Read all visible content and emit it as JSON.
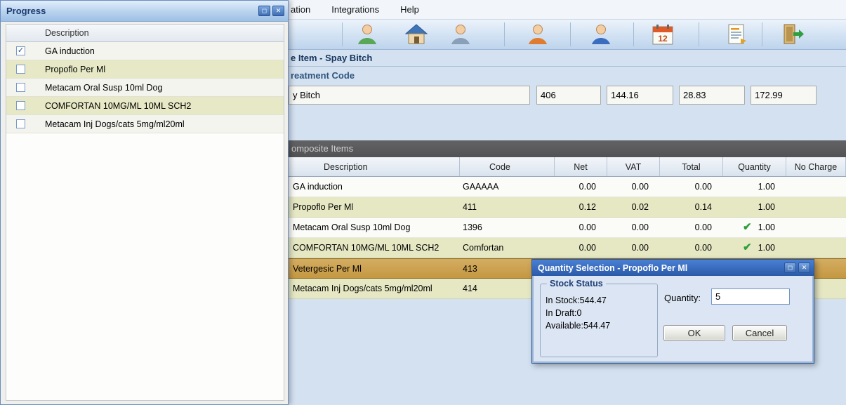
{
  "icons": {
    "check_green": "✔",
    "checkbox_check": "✓",
    "restore": "◻",
    "close": "✕"
  },
  "colors": {
    "selected_row": "#c9a052",
    "alt_row": "#e6e8c4",
    "accent_blue": "#2f62b0",
    "check_green": "#2e9e3a"
  },
  "menu": {
    "items": [
      {
        "label": "ation"
      },
      {
        "label": "Integrations"
      },
      {
        "label": "Help"
      }
    ]
  },
  "toolbar": {
    "calendar_label": "12",
    "icon_names": [
      "patient",
      "home",
      "groom",
      "client",
      "staff",
      "diary",
      "report",
      "exit"
    ]
  },
  "main": {
    "page_title": "e Item - Spay Bitch",
    "section_title": "reatment Code",
    "treatment_name": "y Bitch",
    "summary_fields": [
      {
        "value": "406"
      },
      {
        "value": "144.16"
      },
      {
        "value": "28.83"
      },
      {
        "value": "172.99"
      }
    ],
    "composite_title": "omposite Items",
    "table": {
      "columns": [
        "Description",
        "Code",
        "Net",
        "VAT",
        "Total",
        "Quantity",
        "No Charge"
      ],
      "rows": [
        {
          "description": "GA induction",
          "code": "GAAAAA",
          "net": "0.00",
          "vat": "0.00",
          "total": "0.00",
          "quantity": "1.00",
          "check": false
        },
        {
          "description": "Propoflo Per Ml",
          "code": "411",
          "net": "0.12",
          "vat": "0.02",
          "total": "0.14",
          "quantity": "1.00",
          "check": false
        },
        {
          "description": "Metacam Oral Susp 10ml Dog",
          "code": "1396",
          "net": "0.00",
          "vat": "0.00",
          "total": "0.00",
          "quantity": "1.00",
          "check": true
        },
        {
          "description": "COMFORTAN 10MG/ML 10ML SCH2",
          "code": "Comfortan",
          "net": "0.00",
          "vat": "0.00",
          "total": "0.00",
          "quantity": "1.00",
          "check": true
        },
        {
          "description": "Vetergesic Per Ml",
          "code": "413",
          "net": "",
          "vat": "",
          "total": "",
          "quantity": "",
          "check": false
        },
        {
          "description": "Metacam Inj Dogs/cats 5mg/ml20ml",
          "code": "414",
          "net": "",
          "vat": "",
          "total": "",
          "quantity": "",
          "check": false
        }
      ]
    }
  },
  "progress_window": {
    "title": "Progress",
    "column_header": "Description",
    "items": [
      {
        "label": "GA induction",
        "checked": true
      },
      {
        "label": "Propoflo Per Ml",
        "checked": false
      },
      {
        "label": "Metacam Oral Susp 10ml Dog",
        "checked": false
      },
      {
        "label": "COMFORTAN 10MG/ML 10ML SCH2",
        "checked": false
      },
      {
        "label": "Metacam Inj Dogs/cats 5mg/ml20ml",
        "checked": false
      }
    ]
  },
  "quantity_dialog": {
    "title": "Quantity Selection - Propoflo Per Ml",
    "stock": {
      "title": "Stock Status",
      "lines": [
        "In Stock:544.47",
        "In Draft:0",
        "Available:544.47"
      ]
    },
    "quantity_label": "Quantity:",
    "quantity_value": "5",
    "ok_label": "OK",
    "cancel_label": "Cancel"
  }
}
